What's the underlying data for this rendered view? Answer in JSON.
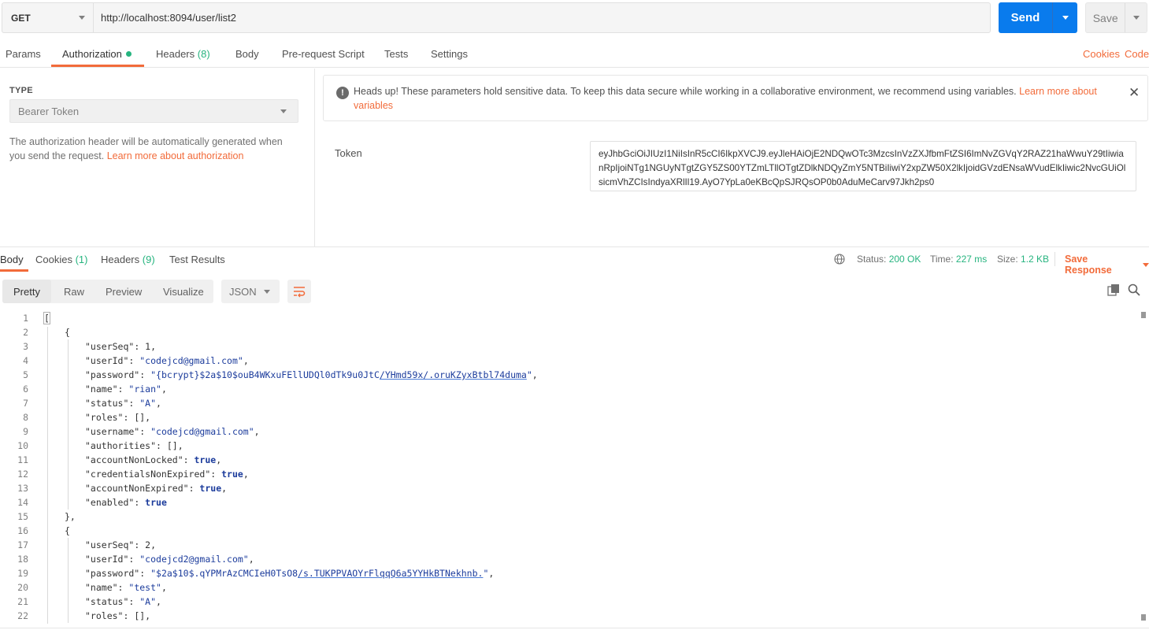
{
  "request": {
    "method": "GET",
    "url": "http://localhost:8094/user/list2",
    "send_label": "Send",
    "save_label": "Save"
  },
  "request_tabs": {
    "params": "Params",
    "authorization": "Authorization",
    "headers": "Headers",
    "headers_count": "(8)",
    "body": "Body",
    "prerequest": "Pre-request Script",
    "tests": "Tests",
    "settings": "Settings",
    "cookies_link": "Cookies",
    "code_link": "Code"
  },
  "auth": {
    "type_label": "TYPE",
    "type_value": "Bearer Token",
    "help_text": "The authorization header will be automatically generated when you send the request. ",
    "help_link": "Learn more about authorization",
    "alert_text": "Heads up! These parameters hold sensitive data. To keep this data secure while working in a collaborative environment, we recommend using variables. ",
    "alert_link": "Learn more about variables",
    "alert_close": "✕",
    "token_label": "Token",
    "token_value": "eyJhbGciOiJIUzI1NiIsInR5cCI6IkpXVCJ9.eyJleHAiOjE2NDQwOTc3MzcsInVzZXJfbmFtZSI6ImNvZGVqY2RAZ21haWwuY29tIiwianRpIjoiNTg1NGUyNTgtZGY5ZS00YTZmLTllOTgtZDlkNDQyZmY5NTBiIiwiY2xpZW50X2lkIjoidGVzdENsaWVudElkIiwic2NvcGUiOlsicmVhZCIsIndyaXRlIl19.AyO7YpLa0eKBcQpSJRQsOP0b0AduMeCarv97Jkh2ps0"
  },
  "response_tabs": {
    "body": "Body",
    "cookies": "Cookies",
    "cookies_count": "(1)",
    "headers": "Headers",
    "headers_count": "(9)",
    "test_results": "Test Results"
  },
  "response_status": {
    "status_label": "Status:",
    "status_value": "200 OK",
    "time_label": "Time:",
    "time_value": "227 ms",
    "size_label": "Size:",
    "size_value": "1.2 KB",
    "save_response": "Save Response"
  },
  "response_toolbar": {
    "pretty": "Pretty",
    "raw": "Raw",
    "preview": "Preview",
    "visualize": "Visualize",
    "language": "JSON"
  },
  "code_lines": [
    {
      "n": "1",
      "indent": 0,
      "parts": [
        [
          "p",
          "["
        ]
      ]
    },
    {
      "n": "2",
      "indent": 1,
      "parts": [
        [
          "p",
          "{"
        ]
      ]
    },
    {
      "n": "3",
      "indent": 2,
      "parts": [
        [
          "k",
          "\"userSeq\""
        ],
        [
          "p",
          ": "
        ],
        [
          "n",
          "1"
        ],
        [
          "p",
          ","
        ]
      ]
    },
    {
      "n": "4",
      "indent": 2,
      "parts": [
        [
          "k",
          "\"userId\""
        ],
        [
          "p",
          ": "
        ],
        [
          "s",
          "\"codejcd@gmail.com\""
        ],
        [
          "p",
          ","
        ]
      ]
    },
    {
      "n": "5",
      "indent": 2,
      "parts": [
        [
          "k",
          "\"password\""
        ],
        [
          "p",
          ": "
        ],
        [
          "s",
          "\"{bcrypt}$2a$10$ouB4WKxuFEllUDQl0dTk9u0JtC"
        ],
        [
          "u",
          "/YHmd59x/.oruKZyxBtbl74duma"
        ],
        [
          "s",
          "\""
        ],
        [
          "p",
          ","
        ]
      ]
    },
    {
      "n": "6",
      "indent": 2,
      "parts": [
        [
          "k",
          "\"name\""
        ],
        [
          "p",
          ": "
        ],
        [
          "s",
          "\"rian\""
        ],
        [
          "p",
          ","
        ]
      ]
    },
    {
      "n": "7",
      "indent": 2,
      "parts": [
        [
          "k",
          "\"status\""
        ],
        [
          "p",
          ": "
        ],
        [
          "s",
          "\"A\""
        ],
        [
          "p",
          ","
        ]
      ]
    },
    {
      "n": "8",
      "indent": 2,
      "parts": [
        [
          "k",
          "\"roles\""
        ],
        [
          "p",
          ": [],"
        ]
      ]
    },
    {
      "n": "9",
      "indent": 2,
      "parts": [
        [
          "k",
          "\"username\""
        ],
        [
          "p",
          ": "
        ],
        [
          "s",
          "\"codejcd@gmail.com\""
        ],
        [
          "p",
          ","
        ]
      ]
    },
    {
      "n": "10",
      "indent": 2,
      "parts": [
        [
          "k",
          "\"authorities\""
        ],
        [
          "p",
          ": [],"
        ]
      ]
    },
    {
      "n": "11",
      "indent": 2,
      "parts": [
        [
          "k",
          "\"accountNonLocked\""
        ],
        [
          "p",
          ": "
        ],
        [
          "b",
          "true"
        ],
        [
          "p",
          ","
        ]
      ]
    },
    {
      "n": "12",
      "indent": 2,
      "parts": [
        [
          "k",
          "\"credentialsNonExpired\""
        ],
        [
          "p",
          ": "
        ],
        [
          "b",
          "true"
        ],
        [
          "p",
          ","
        ]
      ]
    },
    {
      "n": "13",
      "indent": 2,
      "parts": [
        [
          "k",
          "\"accountNonExpired\""
        ],
        [
          "p",
          ": "
        ],
        [
          "b",
          "true"
        ],
        [
          "p",
          ","
        ]
      ]
    },
    {
      "n": "14",
      "indent": 2,
      "parts": [
        [
          "k",
          "\"enabled\""
        ],
        [
          "p",
          ": "
        ],
        [
          "b",
          "true"
        ]
      ]
    },
    {
      "n": "15",
      "indent": 1,
      "parts": [
        [
          "p",
          "},"
        ]
      ]
    },
    {
      "n": "16",
      "indent": 1,
      "parts": [
        [
          "p",
          "{"
        ]
      ]
    },
    {
      "n": "17",
      "indent": 2,
      "parts": [
        [
          "k",
          "\"userSeq\""
        ],
        [
          "p",
          ": "
        ],
        [
          "n",
          "2"
        ],
        [
          "p",
          ","
        ]
      ]
    },
    {
      "n": "18",
      "indent": 2,
      "parts": [
        [
          "k",
          "\"userId\""
        ],
        [
          "p",
          ": "
        ],
        [
          "s",
          "\"codejcd2@gmail.com\""
        ],
        [
          "p",
          ","
        ]
      ]
    },
    {
      "n": "19",
      "indent": 2,
      "parts": [
        [
          "k",
          "\"password\""
        ],
        [
          "p",
          ": "
        ],
        [
          "s",
          "\"$2a$10$.qYPMrAzCMCIeH0TsO8"
        ],
        [
          "u",
          "/s.TUKPPVAOYrFlqqQ6a5YYHkBTNekhnb."
        ],
        [
          "s",
          "\""
        ],
        [
          "p",
          ","
        ]
      ]
    },
    {
      "n": "20",
      "indent": 2,
      "parts": [
        [
          "k",
          "\"name\""
        ],
        [
          "p",
          ": "
        ],
        [
          "s",
          "\"test\""
        ],
        [
          "p",
          ","
        ]
      ]
    },
    {
      "n": "21",
      "indent": 2,
      "parts": [
        [
          "k",
          "\"status\""
        ],
        [
          "p",
          ": "
        ],
        [
          "s",
          "\"A\""
        ],
        [
          "p",
          ","
        ]
      ]
    },
    {
      "n": "22",
      "indent": 2,
      "parts": [
        [
          "k",
          "\"roles\""
        ],
        [
          "p",
          ": [],"
        ]
      ]
    }
  ],
  "colors": {
    "accent": "#f26b3a",
    "send_blue": "#097bed",
    "success_green": "#26b47f"
  },
  "icons": {
    "method_caret": "chevron-down-icon",
    "alert": "info-icon",
    "globe": "globe-icon",
    "copy": "copy-icon",
    "search": "search-icon",
    "wrap": "wrap-lines-icon"
  }
}
